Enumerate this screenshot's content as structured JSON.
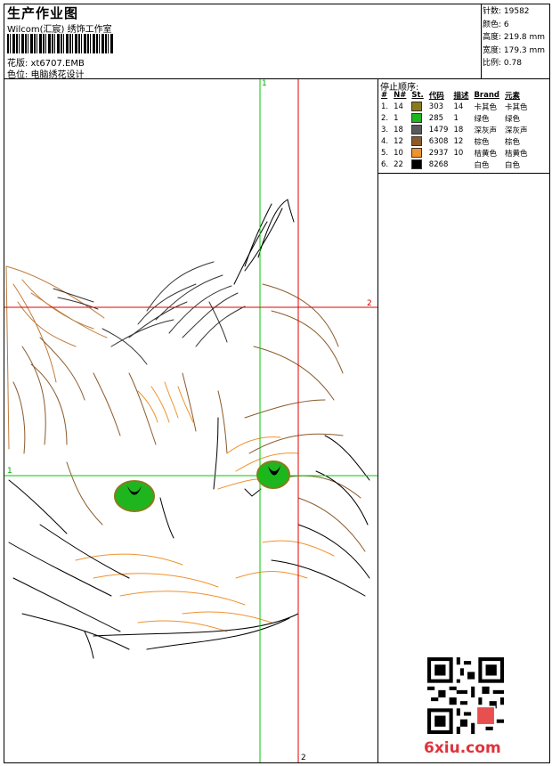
{
  "header": {
    "title": "生产作业图",
    "studio": "Wilcom(汇宸) 绣饰工作室",
    "design_label": "花版: xt6707.EMB",
    "color_label": "色位: 电脑绣花设计"
  },
  "stats": {
    "stitches": "针数: 19582",
    "colors": "颜色: 6",
    "height": "高度: 219.8 mm",
    "width": "宽度: 179.3 mm",
    "scale": "比例: 0.78"
  },
  "sequence": {
    "title": "停止顺序:",
    "headers": [
      "#",
      "N#",
      "St.",
      "代码",
      "描述",
      "Brand",
      "元素"
    ],
    "rows": [
      {
        "n": "1.",
        "id": "14",
        "swatch": "#8a7a1e",
        "st": "303",
        "code": "14",
        "desc": "卡其色",
        "brand": "卡其色"
      },
      {
        "n": "2.",
        "id": "1",
        "swatch": "#1fb51f",
        "st": "285",
        "code": "1",
        "desc": "绿色",
        "brand": "绿色"
      },
      {
        "n": "3.",
        "id": "18",
        "swatch": "#5a5a5a",
        "st": "1479",
        "code": "18",
        "desc": "深灰声",
        "brand": "深灰声"
      },
      {
        "n": "4.",
        "id": "12",
        "swatch": "#8a5a2b",
        "st": "6308",
        "code": "12",
        "desc": "棕色",
        "brand": "棕色"
      },
      {
        "n": "5.",
        "id": "10",
        "swatch": "#f0922e",
        "st": "2937",
        "code": "10",
        "desc": "桔黄色",
        "brand": "桔黄色"
      },
      {
        "n": "6.",
        "id": "22",
        "swatch": "#000000",
        "st": "8268",
        "code": "",
        "desc": "白色",
        "brand": "白色"
      }
    ]
  },
  "axes": {
    "green_v": "1",
    "red_h": "2",
    "green_h": "1",
    "red_v": "2"
  },
  "watermark": "6xiu.com"
}
